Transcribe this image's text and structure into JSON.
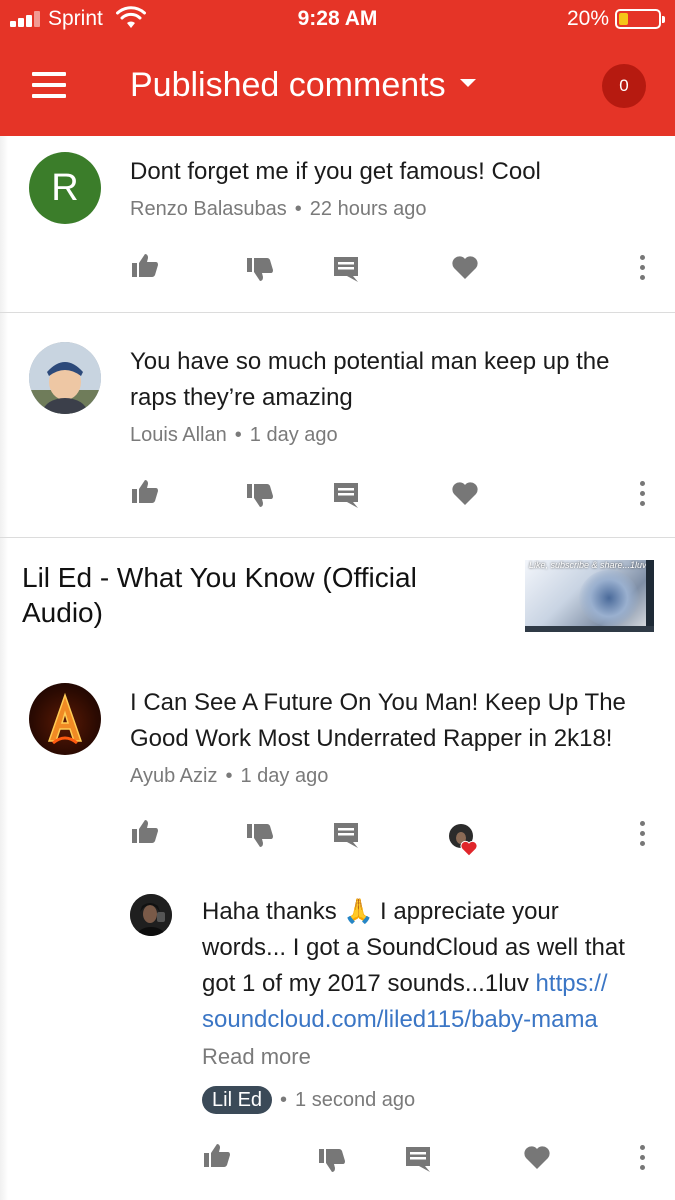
{
  "status_bar": {
    "carrier": "Sprint",
    "time": "9:28 AM",
    "battery": "20%"
  },
  "app_bar": {
    "title": "Published comments",
    "count": "0"
  },
  "colors": {
    "app_bar": "#e53427",
    "badge": "#b61a10",
    "link": "#3b76c5",
    "avatar_r": "#3b7d2a"
  },
  "comments": [
    {
      "avatar_letter": "R",
      "text": "Dont forget me if you get famous! Cool",
      "author": "Renzo Balasubas",
      "time": "22 hours ago"
    },
    {
      "text_line1": "You have so much potential man keep up the",
      "text_line2": "raps they’re amazing",
      "author": "Louis Allan",
      "time": "1 day ago"
    }
  ],
  "video": {
    "title_line1": "Lil Ed - What You Know (Official",
    "title_line2": "Audio)",
    "thumb_text": "Like, subscribe & share...1luv"
  },
  "thread": {
    "text_line1": "I Can See A Future On You Man! Keep Up The",
    "text_line2": "Good Work Most Underrated Rapper in 2k18!",
    "author": "Ayub Aziz",
    "time": "1 day ago",
    "avatar_letter": "A",
    "reply": {
      "line1_a": "Haha thanks",
      "line1_emoji": "🙏",
      "line1_b": "I appreciate your",
      "line2": "words... I got a SoundCloud as well that",
      "line3_a": "got 1 of my 2017 sounds...1luv",
      "line3_link": "https://",
      "line4_link": "soundcloud.com/liled115/baby-mama",
      "read_more": "Read more",
      "author_badge": "Lil Ed",
      "time": "1 second ago"
    }
  },
  "icons": {
    "like": "thumbs-up-icon",
    "dislike": "thumbs-down-icon",
    "reply": "reply-comment-icon",
    "heart": "heart-icon",
    "more": "more-vertical-icon"
  }
}
